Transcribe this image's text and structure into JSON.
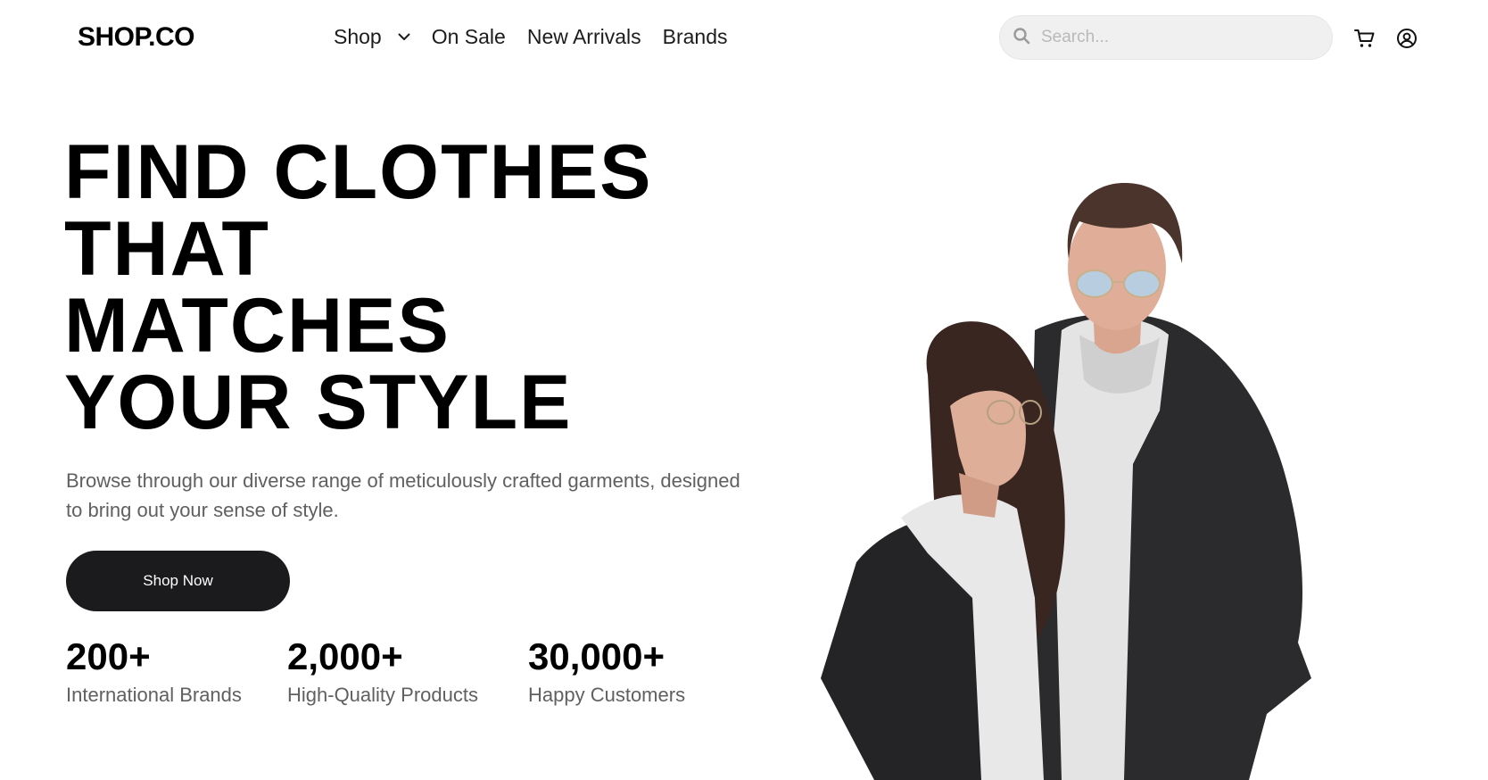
{
  "header": {
    "logo": "SHOP.CO",
    "nav": [
      {
        "label": "Shop",
        "has_dropdown": true
      },
      {
        "label": "On Sale"
      },
      {
        "label": "New Arrivals"
      },
      {
        "label": "Brands"
      }
    ],
    "search": {
      "placeholder": "Search...",
      "value": ""
    },
    "icons": [
      "search-icon",
      "cart-icon",
      "user-account-icon",
      "chevron-down-icon"
    ]
  },
  "hero": {
    "title_lines": [
      "FIND CLOTHES",
      "THAT",
      "MATCHES",
      "YOUR STYLE"
    ],
    "description": "Browse through our diverse range of meticulously crafted garments, designed to bring out your sense of style.",
    "cta_label": "Shop Now",
    "stats": [
      {
        "value": "200+",
        "label": "International Brands"
      },
      {
        "value": "2,000+",
        "label": "High-Quality Products"
      },
      {
        "value": "30,000+",
        "label": "Happy Customers"
      }
    ]
  },
  "colors": {
    "primary_text": "#000000",
    "secondary_text": "#606060",
    "button_bg": "#1b1b1d",
    "search_bg": "#f0f0f0",
    "background": "#ffffff"
  }
}
